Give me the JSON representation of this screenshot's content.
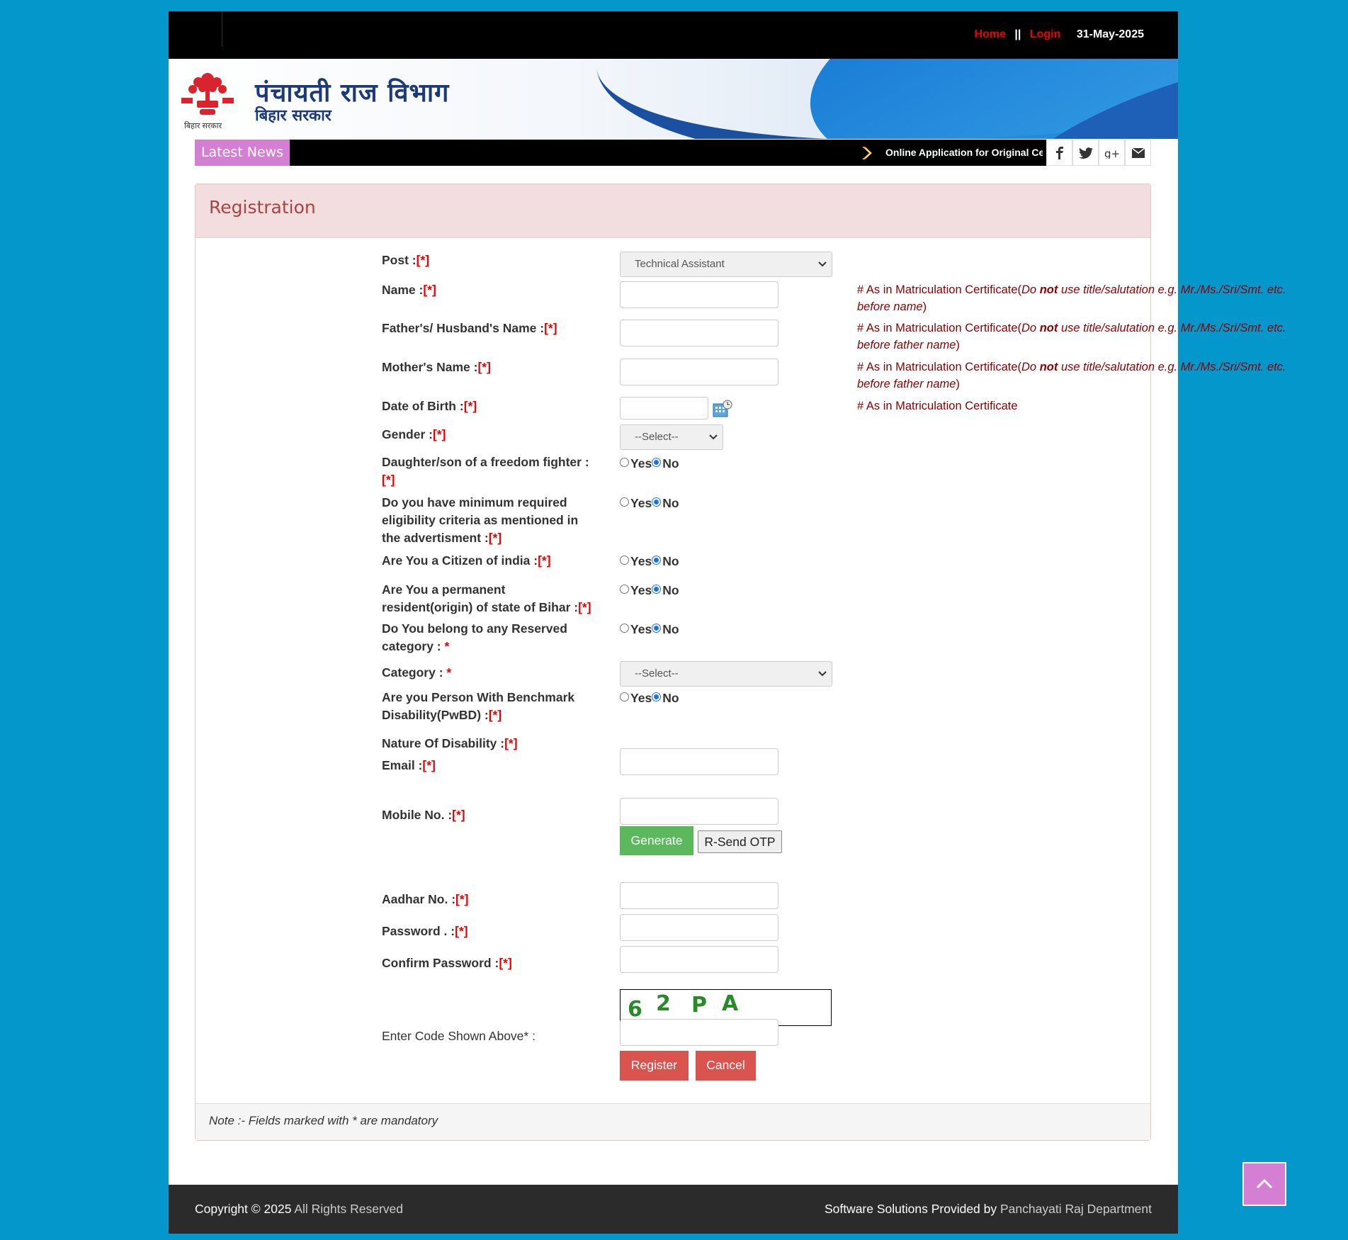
{
  "topbar": {
    "home_label": "Home",
    "separator": "||",
    "login_label": "Login",
    "date": "31-May-2025"
  },
  "header": {
    "title": "पंचायती राज विभाग",
    "subtitle": "बिहार सरकार",
    "emblem_caption": "बिहार सरकार"
  },
  "news": {
    "label": "Latest News",
    "ticker_text": "Online Application for Original Certificate"
  },
  "social": [
    "facebook-icon",
    "twitter-icon",
    "google-plus-icon",
    "mail-icon"
  ],
  "form": {
    "title": "Registration",
    "post": {
      "label": "Post :",
      "req": "[*]",
      "value": "Technical Assistant"
    },
    "name": {
      "label": "Name :",
      "req": "[*]",
      "hint_prefix": "# As in Matriculation Certificate(",
      "hint_italic": "Do ",
      "hint_bold": "not",
      "hint_italic2": " use title/salutation e.g. Mr./Ms./Sri/Smt. etc. before name",
      "hint_suffix": ")"
    },
    "father": {
      "label": "Father's/ Husband's Name :",
      "req": "[*]",
      "hint_prefix": "# As in Matriculation Certificate(",
      "hint_italic": "Do ",
      "hint_bold": "not",
      "hint_italic2": " use title/salutation e.g. Mr./Ms./Sri/Smt. etc. before father name",
      "hint_suffix": ")"
    },
    "mother": {
      "label": "Mother's Name :",
      "req": "[*]",
      "hint_prefix": "# As in Matriculation Certificate(",
      "hint_italic": "Do ",
      "hint_bold": "not",
      "hint_italic2": " use title/salutation e.g. Mr./Ms./Sri/Smt. etc. before father name",
      "hint_suffix": ")"
    },
    "dob": {
      "label": "Date of Birth :",
      "req": "[*]",
      "hint": "# As in Matriculation Certificate"
    },
    "gender": {
      "label": "Gender :",
      "req": "[*]",
      "value": "--Select--"
    },
    "freedom": {
      "label": "Daughter/son of a freedom fighter :",
      "req": "[*]"
    },
    "eligibility": {
      "label": "Do you have minimum required eligibility criteria as mentioned in the advertisment :",
      "req": "[*]"
    },
    "citizen": {
      "label": "Are You a Citizen of india :",
      "req": "[*]"
    },
    "resident": {
      "label": "Are You a permanent resident(origin) of state of Bihar :",
      "req": "[*]"
    },
    "reserved": {
      "label": "Do You belong to any Reserved category : ",
      "req": "*"
    },
    "category": {
      "label": "Category : ",
      "req": "*",
      "value": "--Select--"
    },
    "pwbd": {
      "label": "Are you Person With Benchmark Disability(PwBD) :",
      "req": "[*]"
    },
    "disability": {
      "label": "Nature Of Disability :",
      "req": "[*]"
    },
    "email": {
      "label": "Email :",
      "req": "[*]"
    },
    "mobile": {
      "label": "Mobile No. :",
      "req": "[*]"
    },
    "generate_label": "Generate",
    "resend_label": "R-Send OTP",
    "aadhar": {
      "label": "Aadhar No. :",
      "req": "[*]"
    },
    "password": {
      "label": "Password . :",
      "req": "[*]"
    },
    "confirm": {
      "label": "Confirm Password :",
      "req": "[*]"
    },
    "captcha": {
      "chars": [
        "6",
        "2",
        "P",
        "A"
      ]
    },
    "code_label": "Enter Code Shown Above* :",
    "register_label": "Register",
    "cancel_label": "Cancel",
    "yes": "Yes",
    "no": "No",
    "note": "Note :- Fields marked with * are mandatory"
  },
  "footer": {
    "copyright_strong": "Copyright © 2025",
    "copyright_rest": " All Rights Reserved",
    "credit_strong": "Software Solutions Provided by ",
    "credit_rest": "Panchayati Raj Department"
  },
  "colors": {
    "page_bg": "#0397cb",
    "accent_pink": "#d47fd4",
    "required": "#ee0000",
    "hint": "#8b0000"
  }
}
